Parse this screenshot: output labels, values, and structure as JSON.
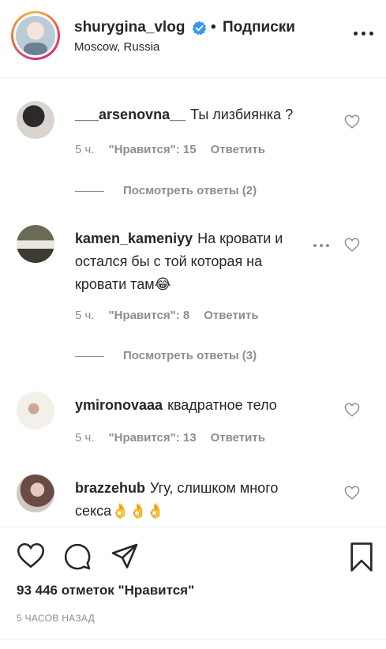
{
  "header": {
    "username": "shurygina_vlog",
    "separator": "•",
    "follow_label": "Подписки",
    "location": "Moscow, Russia"
  },
  "comments": [
    {
      "username": "___arsenovna__",
      "text": "Ты лизбиянка ?",
      "time": "5 ч.",
      "likes": "\"Нравится\": 15",
      "reply": "Ответить",
      "replies": "Посмотреть ответы (2)"
    },
    {
      "username": "kamen_kameniyy",
      "text": "На кровати и остался бы с той которая на кровати там😂",
      "time": "5 ч.",
      "likes": "\"Нравится\": 8",
      "reply": "Ответить",
      "replies": "Посмотреть ответы (3)"
    },
    {
      "username": "ymironovaaa",
      "text": "квадратное тело",
      "time": "5 ч.",
      "likes": "\"Нравится\": 13",
      "reply": "Ответить"
    },
    {
      "username": "brazzehub",
      "text": "Угу, слишком много секса👌👌👌"
    }
  ],
  "post": {
    "likes_text": "93 446 отметок \"Нравится\"",
    "time_ago": "5 ЧАСОВ НАЗАД"
  },
  "icons": {
    "verified": "verified-badge-icon",
    "more": "more-options-icon",
    "heart": "heart-icon",
    "comment": "comment-icon",
    "share": "share-icon",
    "bookmark": "bookmark-icon"
  },
  "colors": {
    "verified_blue": "#3897f0",
    "secondary_text": "#8e8e8e",
    "primary_text": "#262626"
  }
}
